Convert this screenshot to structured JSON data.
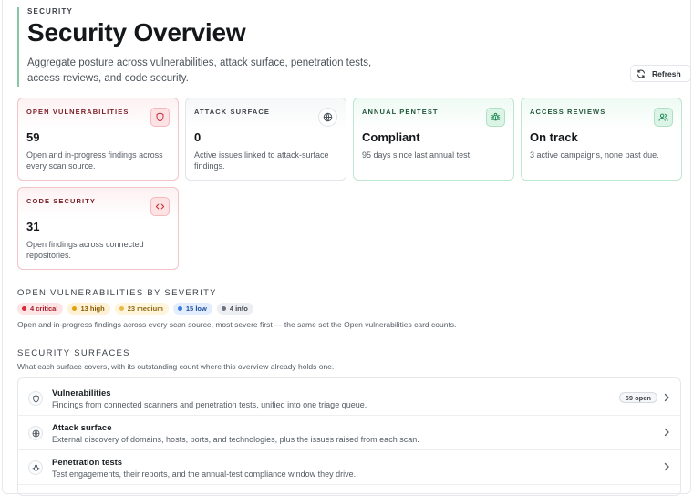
{
  "header": {
    "eyebrow": "SECURITY",
    "title": "Security Overview",
    "subtitle": "Aggregate posture across vulnerabilities, attack surface, penetration tests, access reviews, and code security.",
    "refresh_label": "Refresh"
  },
  "cards": [
    {
      "label": "OPEN VULNERABILITIES",
      "value": "59",
      "desc": "Open and in-progress findings across every scan source.",
      "icon": "shield-icon",
      "tone": "red"
    },
    {
      "label": "ATTACK SURFACE",
      "value": "0",
      "desc": "Active issues linked to attack-surface findings.",
      "icon": "globe-icon",
      "tone": "gray"
    },
    {
      "label": "ANNUAL PENTEST",
      "value": "Compliant",
      "desc": "95 days since last annual test",
      "icon": "bug-icon",
      "tone": "green"
    },
    {
      "label": "ACCESS REVIEWS",
      "value": "On track",
      "desc": "3 active campaigns, none past due.",
      "icon": "users-icon",
      "tone": "green"
    },
    {
      "label": "CODE SECURITY",
      "value": "31",
      "desc": "Open findings across connected repositories.",
      "icon": "code-icon",
      "tone": "red"
    }
  ],
  "severity": {
    "title": "OPEN VULNERABILITIES BY SEVERITY",
    "pills": [
      {
        "label": "4 critical",
        "level": "critical"
      },
      {
        "label": "13 high",
        "level": "high"
      },
      {
        "label": "23 medium",
        "level": "medium"
      },
      {
        "label": "15 low",
        "level": "low"
      },
      {
        "label": "4 info",
        "level": "info"
      }
    ],
    "desc": "Open and in-progress findings across every scan source, most severe first — the same set the Open vulnerabilities card counts."
  },
  "surfaces": {
    "title": "SECURITY SURFACES",
    "desc": "What each surface covers, with its outstanding count where this overview already holds one.",
    "rows": [
      {
        "name": "Vulnerabilities",
        "desc": "Findings from connected scanners and penetration tests, unified into one triage queue.",
        "badge": "59 open",
        "icon": "shield-icon"
      },
      {
        "name": "Attack surface",
        "desc": "External discovery of domains, hosts, ports, and technologies, plus the issues raised from each scan.",
        "badge": "",
        "icon": "globe-icon"
      },
      {
        "name": "Penetration tests",
        "desc": "Test engagements, their reports, and the annual-test compliance window they drive.",
        "badge": "",
        "icon": "bug-icon"
      }
    ]
  },
  "colors": {
    "accent_green": "#1f8a53",
    "danger_red": "#c2343f",
    "header_rule": "#86c7a4"
  }
}
